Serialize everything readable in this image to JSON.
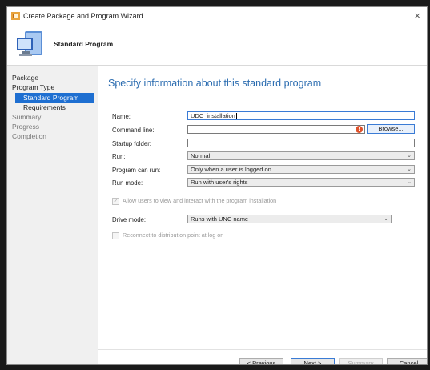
{
  "window": {
    "title": "Create Package and Program Wizard",
    "close_glyph": "×"
  },
  "header": {
    "title": "Standard Program"
  },
  "nav": {
    "package": "Package",
    "program_type": "Program Type",
    "standard_program": "Standard Program",
    "requirements": "Requirements",
    "summary": "Summary",
    "progress": "Progress",
    "completion": "Completion"
  },
  "main": {
    "heading": "Specify information about this standard program",
    "name_label": "Name:",
    "name_value": "UDC_installation",
    "command_line_label": "Command line:",
    "command_line_value": "",
    "browse_label": "Browse...",
    "startup_folder_label": "Startup folder:",
    "startup_folder_value": "",
    "run_label": "Run:",
    "run_value": "Normal",
    "program_can_run_label": "Program can run:",
    "program_can_run_value": "Only when a user is logged on",
    "run_mode_label": "Run mode:",
    "run_mode_value": "Run with user's rights",
    "allow_interact_label": "Allow users to view and interact with the program installation",
    "drive_mode_label": "Drive mode:",
    "drive_mode_value": "Runs with UNC name",
    "reconnect_label": "Reconnect to distribution point at log on",
    "warning_glyph": "!"
  },
  "footer": {
    "previous": "< Previous",
    "next": "Next >",
    "summary": "Summary",
    "cancel": "Cancel"
  },
  "icons": {
    "chevron_glyph": "⌄",
    "check_glyph": "✓"
  }
}
